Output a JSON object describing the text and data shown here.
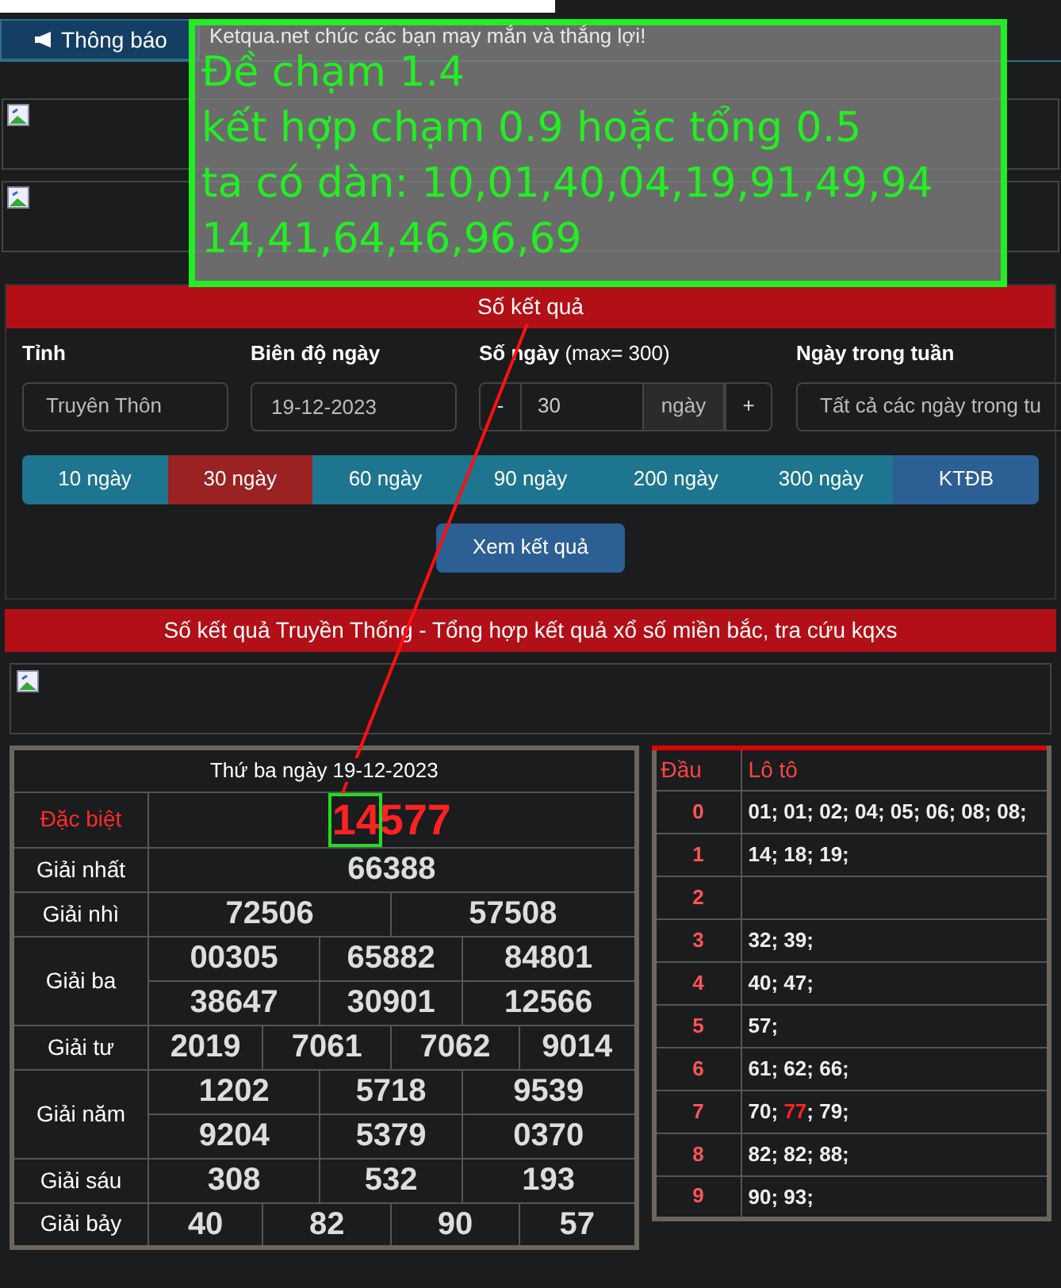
{
  "notice": {
    "button": "Thông báo",
    "message": "Ketqua.net chúc các bạn may mắn và thắng lợi!"
  },
  "annotation": {
    "lines": [
      "Đề chạm 1.4",
      "kết hợp chạm 0.9 hoặc tổng 0.5",
      "ta có dàn: 10,01,40,04,19,91,49,94",
      "14,41,64,46,96,69"
    ]
  },
  "search_panel": {
    "title": "Số kết quả",
    "fields": [
      {
        "label": "Tỉnh",
        "kind": "select",
        "value": "Truyên Thôn"
      },
      {
        "label": "Biên độ ngày",
        "kind": "text",
        "value": "19-12-2023"
      },
      {
        "label": "**Số ngày** (max= 300)",
        "kind": "stepper",
        "minus": "-",
        "value": "30",
        "unit": "ngày",
        "plus": "+"
      },
      {
        "label": "Ngày trong tuần",
        "kind": "select",
        "value": "Tất cả các ngày trong tu"
      }
    ],
    "ranges": [
      {
        "label": "10 ngày",
        "kind": "range",
        "selected": false
      },
      {
        "label": "30 ngày",
        "kind": "range",
        "selected": true
      },
      {
        "label": "60 ngày",
        "kind": "range",
        "selected": false
      },
      {
        "label": "90 ngày",
        "kind": "range",
        "selected": false
      },
      {
        "label": "200 ngày",
        "kind": "range",
        "selected": false
      },
      {
        "label": "300 ngày",
        "kind": "range",
        "selected": false
      },
      {
        "label": "KTĐB",
        "kind": "special",
        "selected": false
      }
    ],
    "submit": "Xem kết quả"
  },
  "results_title": "Số kết quả Truyền Thống - Tổng hợp kết quả xổ số miền bắc, tra cứu kqxs",
  "results": {
    "date": "Thứ ba ngày 19-12-2023",
    "special": {
      "label": "Đặc biệt",
      "parts": [
        {
          "text": "14",
          "boxed": true
        },
        {
          "text": "577",
          "boxed": false
        }
      ]
    },
    "prizes": [
      {
        "label": "Giải nhất",
        "rows": [
          [
            "66388"
          ]
        ]
      },
      {
        "label": "Giải nhì",
        "rows": [
          [
            "72506",
            "57508"
          ]
        ]
      },
      {
        "label": "Giải ba",
        "rows": [
          [
            "00305",
            "65882",
            "84801"
          ],
          [
            "38647",
            "30901",
            "12566"
          ]
        ]
      },
      {
        "label": "Giải tư",
        "rows": [
          [
            "2019",
            "7061",
            "7062",
            "9014"
          ]
        ]
      },
      {
        "label": "Giải năm",
        "rows": [
          [
            "1202",
            "5718",
            "9539"
          ],
          [
            "9204",
            "5379",
            "0370"
          ]
        ]
      },
      {
        "label": "Giải sáu",
        "rows": [
          [
            "308",
            "532",
            "193"
          ]
        ]
      },
      {
        "label": "Giải bảy",
        "rows": [
          [
            "40",
            "82",
            "90",
            "57"
          ]
        ]
      }
    ]
  },
  "loto": {
    "columns": [
      "Đầu",
      "Lô tô"
    ],
    "rows": [
      {
        "head": "0",
        "parts": [
          {
            "text": "01; 01; 02; 04; 05; 06; 08; 08;",
            "hot": false
          }
        ]
      },
      {
        "head": "1",
        "parts": [
          {
            "text": "14; 18; 19;",
            "hot": false
          }
        ]
      },
      {
        "head": "2",
        "parts": []
      },
      {
        "head": "3",
        "parts": [
          {
            "text": "32; 39;",
            "hot": false
          }
        ]
      },
      {
        "head": "4",
        "parts": [
          {
            "text": "40; 47;",
            "hot": false
          }
        ]
      },
      {
        "head": "5",
        "parts": [
          {
            "text": "57;",
            "hot": false
          }
        ]
      },
      {
        "head": "6",
        "parts": [
          {
            "text": "61; 62; 66;",
            "hot": false
          }
        ]
      },
      {
        "head": "7",
        "parts": [
          {
            "text": "70; ",
            "hot": false
          },
          {
            "text": "77",
            "hot": true
          },
          {
            "text": "; 79;",
            "hot": false
          }
        ]
      },
      {
        "head": "8",
        "parts": [
          {
            "text": "82; 82; 88;",
            "hot": false
          }
        ]
      },
      {
        "head": "9",
        "parts": [
          {
            "text": "90; 93;",
            "hot": false
          }
        ]
      }
    ]
  }
}
